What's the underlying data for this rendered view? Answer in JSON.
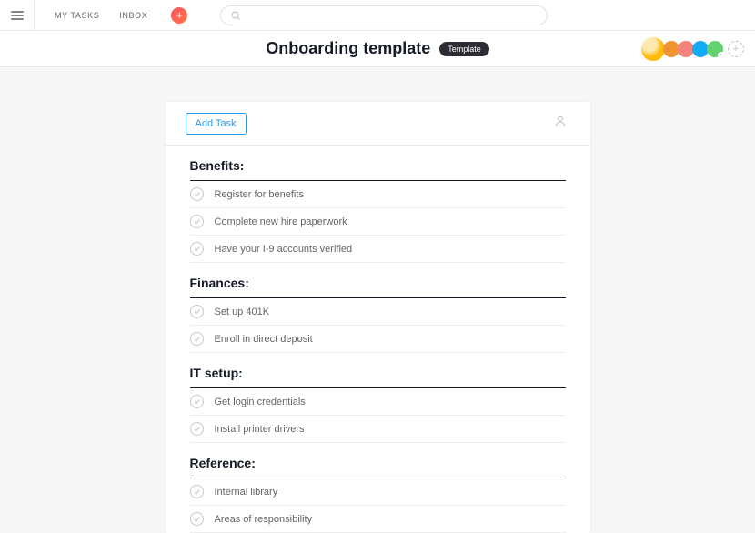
{
  "nav": {
    "my_tasks": "MY TASKS",
    "inbox": "INBOX",
    "search_placeholder": ""
  },
  "project": {
    "title": "Onboarding template",
    "badge": "Template"
  },
  "actions": {
    "add_task": "Add Task"
  },
  "sections": {
    "0": {
      "heading": "Benefits:",
      "tasks": {
        "0": "Register for benefits",
        "1": "Complete new hire paperwork",
        "2": "Have your I-9 accounts verified"
      }
    },
    "1": {
      "heading": "Finances:",
      "tasks": {
        "0": "Set up 401K",
        "1": "Enroll in direct deposit"
      }
    },
    "2": {
      "heading": "IT setup:",
      "tasks": {
        "0": "Get login credentials",
        "1": "Install printer drivers"
      }
    },
    "3": {
      "heading": "Reference:",
      "tasks": {
        "0": "Internal library",
        "1": "Areas of responsibility"
      }
    }
  }
}
